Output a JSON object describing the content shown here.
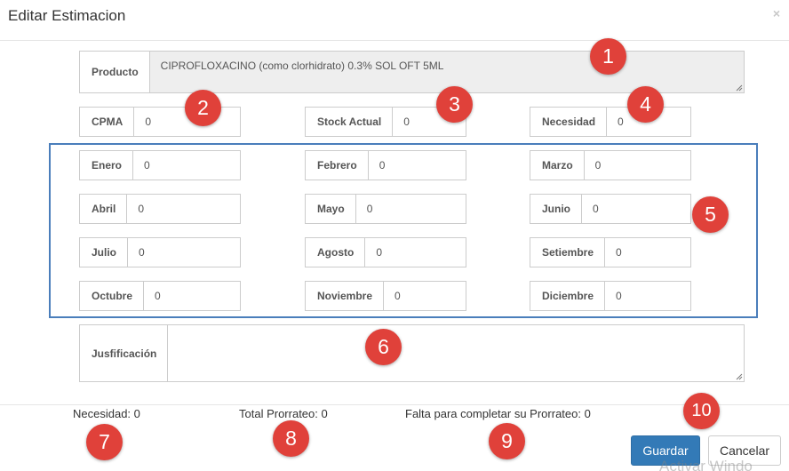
{
  "dialog": {
    "title": "Editar Estimacion",
    "close_symbol": "×"
  },
  "producto": {
    "label": "Producto",
    "value": "CIPROFLOXACINO (como clorhidrato) 0.3% SOL OFT 5ML"
  },
  "cpma": {
    "label": "CPMA",
    "value": "0"
  },
  "stock_actual": {
    "label": "Stock Actual",
    "value": "0"
  },
  "necesidad": {
    "label": "Necesidad",
    "value": "0"
  },
  "months": [
    {
      "label": "Enero",
      "value": "0"
    },
    {
      "label": "Febrero",
      "value": "0"
    },
    {
      "label": "Marzo",
      "value": "0"
    },
    {
      "label": "Abril",
      "value": "0"
    },
    {
      "label": "Mayo",
      "value": "0"
    },
    {
      "label": "Junio",
      "value": "0"
    },
    {
      "label": "Julio",
      "value": "0"
    },
    {
      "label": "Agosto",
      "value": "0"
    },
    {
      "label": "Setiembre",
      "value": "0"
    },
    {
      "label": "Octubre",
      "value": "0"
    },
    {
      "label": "Noviembre",
      "value": "0"
    },
    {
      "label": "Diciembre",
      "value": "0"
    }
  ],
  "justificacion": {
    "label": "Jusfificación",
    "value": ""
  },
  "footer": {
    "necesidad_text": "Necesidad: 0",
    "total_prorrateo_text": "Total Prorrateo: 0",
    "falta_text": "Falta para completar su Prorrateo: 0"
  },
  "buttons": {
    "guardar": "Guardar",
    "cancelar": "Cancelar"
  },
  "badges": [
    "1",
    "2",
    "3",
    "4",
    "5",
    "6",
    "7",
    "8",
    "9",
    "10"
  ],
  "watermark": "Activar Windo",
  "colors": {
    "badge": "#e0413a",
    "highlight_border": "#4a7ebb",
    "primary": "#337ab7"
  }
}
